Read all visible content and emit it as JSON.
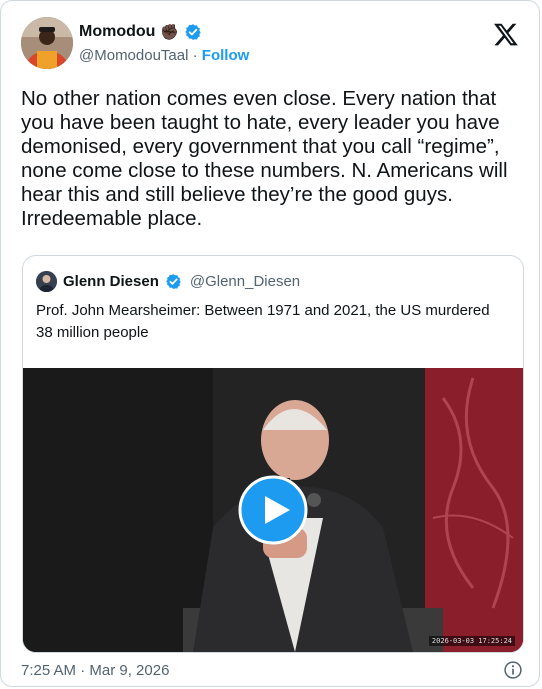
{
  "author": {
    "display_name": "Momodou",
    "emoji": "✊🏿",
    "handle": "@MomodouTaal",
    "separator": "·",
    "follow_label": "Follow"
  },
  "tweet": {
    "text": "No other nation comes even close. Every nation that you have been taught to hate, every leader you have demonised, every government that you call “regime”, none come close to these numbers. N. Americans will hear this and still believe they’re the good guys. Irredeemable place."
  },
  "quoted": {
    "display_name": "Glenn Diesen",
    "handle": "@Glenn_Diesen",
    "text": "Prof. John Mearsheimer: Between 1971 and 2021, the US murdered 38 million people",
    "video_timestamp": "2026-03-03 17:25:24"
  },
  "footer": {
    "time": "7:25 AM · Mar 9, 2026"
  },
  "icons": {
    "brand": "x-logo-icon",
    "verified": "verified-badge-icon",
    "play": "play-icon",
    "info": "info-icon"
  },
  "colors": {
    "accent": "#1d9bf0",
    "text": "#0f1419",
    "muted": "#536471",
    "border": "#cfd9de"
  }
}
